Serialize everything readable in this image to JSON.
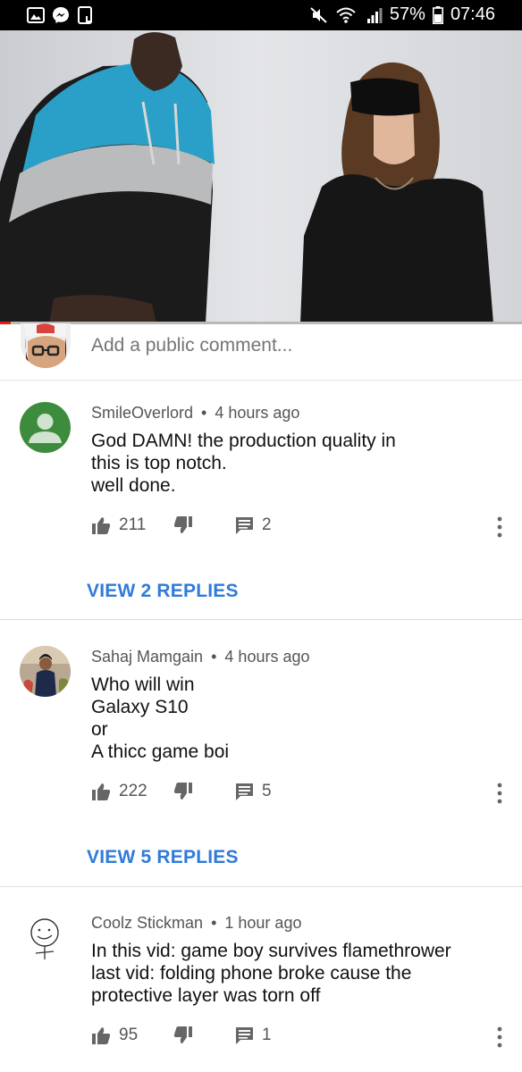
{
  "status_bar": {
    "battery": "57%",
    "time": "07:46",
    "left_icons": [
      "gallery-icon",
      "messenger-icon",
      "screenshot-icon"
    ],
    "right_icons": [
      "mute-icon",
      "wifi-icon",
      "signal-icon",
      "battery-icon"
    ]
  },
  "video": {
    "progress_fraction": 0.02
  },
  "comment_box": {
    "placeholder": "Add a public comment..."
  },
  "comments": [
    {
      "author": "SmileOverlord",
      "time": "4 hours ago",
      "lines": [
        "God DAMN! the production quality in",
        "this is top notch.",
        "well done."
      ],
      "likes": "211",
      "replies_count": "2",
      "view_replies": "VIEW 2 REPLIES"
    },
    {
      "author": "Sahaj Mamgain",
      "time": "4 hours ago",
      "lines": [
        "Who will win",
        "Galaxy S10",
        "or",
        "A thicc game boi"
      ],
      "likes": "222",
      "replies_count": "5",
      "view_replies": "VIEW 5 REPLIES"
    },
    {
      "author": "Coolz Stickman",
      "time": "1 hour ago",
      "lines": [
        "In this vid: game boy survives flamethrower",
        "last vid: folding phone broke cause the",
        "protective layer was torn off"
      ],
      "likes": "95",
      "replies_count": "1"
    }
  ],
  "separator": "•",
  "colors": {
    "link": "#2f7bd9",
    "progress": "#e0201b",
    "meta_text": "#555555"
  }
}
